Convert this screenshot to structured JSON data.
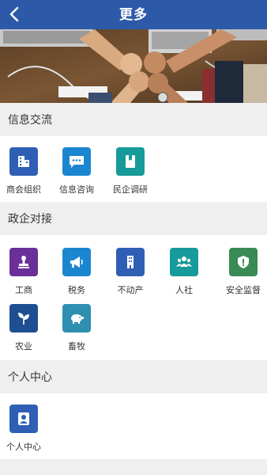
{
  "header": {
    "title": "更多",
    "back_icon": "chevron-left-icon"
  },
  "banner": {
    "image": "teamwork-fist-bump-photo"
  },
  "sections": [
    {
      "title": "信息交流",
      "items": [
        {
          "label": "商会组织",
          "icon": "building-icon",
          "color": "#2f5fb5"
        },
        {
          "label": "信息咨询",
          "icon": "chat-bubble-icon",
          "color": "#1b86d0"
        },
        {
          "label": "民企调研",
          "icon": "bookmark-icon",
          "color": "#169a9a"
        }
      ]
    },
    {
      "title": "政企对接",
      "items": [
        {
          "label": "工商",
          "icon": "stamp-icon",
          "color": "#6a2f98"
        },
        {
          "label": "税务",
          "icon": "megaphone-icon",
          "color": "#1b86d0"
        },
        {
          "label": "不动产",
          "icon": "tower-icon",
          "color": "#2f5fb5"
        },
        {
          "label": "人社",
          "icon": "people-icon",
          "color": "#169a9a"
        },
        {
          "label": "安全监督",
          "icon": "shield-icon",
          "color": "#3a8a55"
        },
        {
          "label": "农业",
          "icon": "sprout-icon",
          "color": "#1e4f91"
        },
        {
          "label": "畜牧",
          "icon": "pig-icon",
          "color": "#2f8fb0"
        }
      ]
    },
    {
      "title": "个人中心",
      "items": [
        {
          "label": "个人中心",
          "icon": "person-icon",
          "color": "#2f5fb5"
        }
      ]
    }
  ]
}
